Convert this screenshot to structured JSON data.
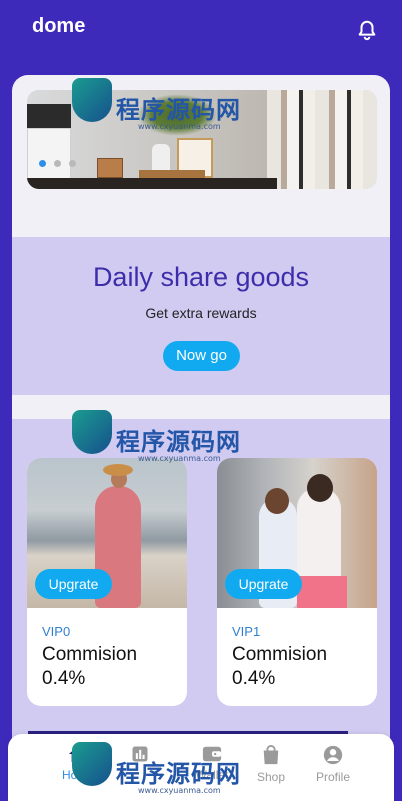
{
  "header": {
    "title": "dome",
    "bell_icon": "bell-icon"
  },
  "banner": {
    "slides": 3,
    "active_index": 0
  },
  "share": {
    "title": "Daily share goods",
    "subtitle": "Get extra rewards",
    "button_label": "Now go"
  },
  "vip_cards": [
    {
      "level": "VIP0",
      "label": "Commision",
      "rate": "0.4%",
      "button_label": "Upgrate"
    },
    {
      "level": "VIP1",
      "label": "Commision",
      "rate": "0.4%",
      "button_label": "Upgrate"
    }
  ],
  "bottom_nav": [
    {
      "label": "Home",
      "icon": "home-icon",
      "active": true
    },
    {
      "label": "",
      "icon": "bar-chart-icon",
      "active": false
    },
    {
      "label": "Wallet",
      "icon": "wallet-icon",
      "active": false
    },
    {
      "label": "Shop",
      "icon": "shopping-bag-icon",
      "active": false
    },
    {
      "label": "Profile",
      "icon": "user-icon",
      "active": false
    }
  ],
  "watermark": {
    "text": "程序源码网",
    "url": "www.cxyuanma.com"
  },
  "colors": {
    "primary": "#3d2aba",
    "accent": "#11aaf0",
    "panel": "#d1cbf2",
    "active_tab": "#2f8fe8"
  }
}
